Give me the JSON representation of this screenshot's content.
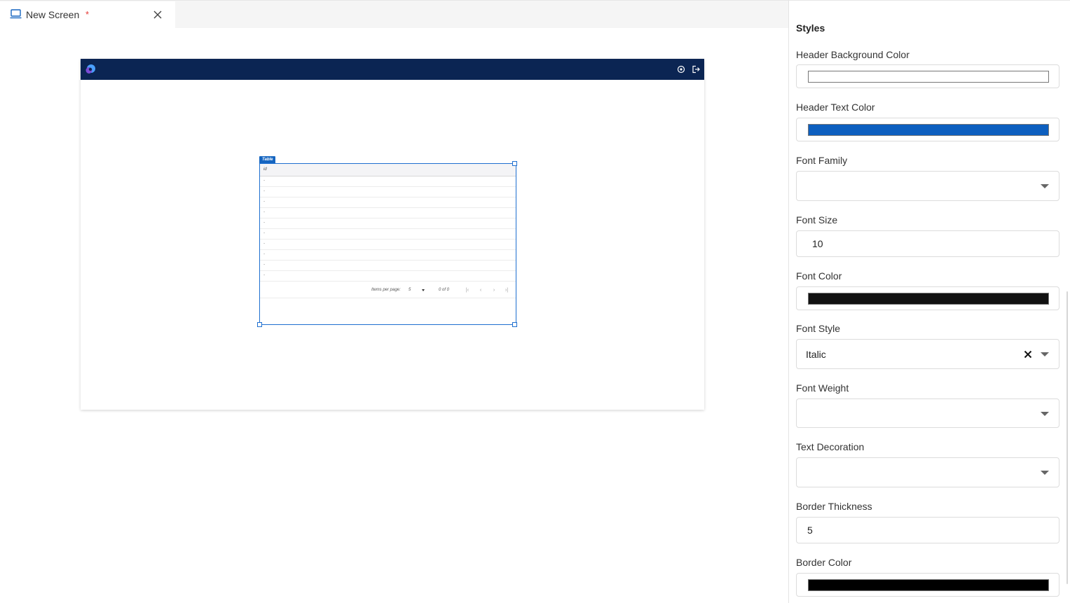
{
  "tab": {
    "title": "New Screen",
    "dirty_marker": "*"
  },
  "canvas": {
    "header_color": "#0b2553",
    "table_widget": {
      "tag": "Table",
      "column_header": "id",
      "rows": [
        "-",
        "-",
        "-",
        "-",
        "-",
        "-",
        "-",
        "-",
        "-",
        "-"
      ],
      "pager": {
        "items_per_page_label": "Items per page:",
        "page_size": "5",
        "range": "0 of 0"
      }
    }
  },
  "styles": {
    "title": "Styles",
    "header_background_color": {
      "label": "Header Background Color",
      "value": "#ffffff"
    },
    "header_text_color": {
      "label": "Header Text Color",
      "value": "#0d5fbf"
    },
    "font_family": {
      "label": "Font Family",
      "value": ""
    },
    "font_size": {
      "label": "Font Size",
      "value": "10"
    },
    "font_color": {
      "label": "Font Color",
      "value": "#111111"
    },
    "font_style": {
      "label": "Font Style",
      "value": "Italic"
    },
    "font_weight": {
      "label": "Font Weight",
      "value": ""
    },
    "text_decoration": {
      "label": "Text Decoration",
      "value": ""
    },
    "border_thickness": {
      "label": "Border Thickness",
      "value": "5"
    },
    "border_color": {
      "label": "Border Color",
      "value": "#000000"
    }
  },
  "icons": {
    "tab": "monitor-icon",
    "close": "close-icon",
    "logo": "app-logo-icon",
    "settings": "settings-icon",
    "logout": "logout-icon",
    "dropdown": "chevron-down-icon",
    "clear": "clear-icon"
  }
}
